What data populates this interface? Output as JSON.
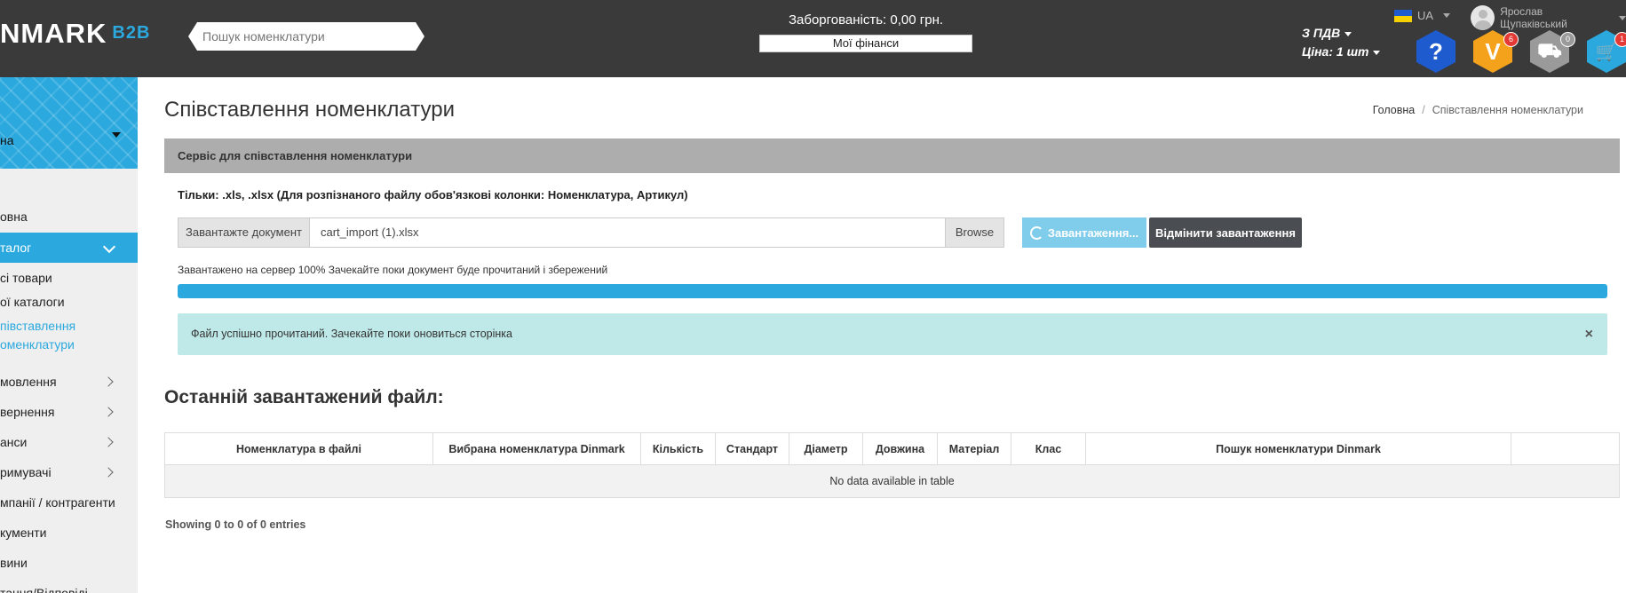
{
  "header": {
    "logo_text": "NMARK",
    "logo_suffix": "B2B",
    "search_placeholder": "Пошук номенклатури",
    "debt_label": "Заборгованість: 0,00 грн.",
    "finances_button": "Мої фінанси",
    "vat_label": "З ПДВ",
    "price_label": "Ціна: 1 шт",
    "language": "UA",
    "user_name": "Ярослав Щупаківський",
    "icons": [
      {
        "name": "help-icon",
        "glyph": "?",
        "color": "#1e5bcf",
        "badge": ""
      },
      {
        "name": "v-icon",
        "glyph": "V",
        "color": "#f4a11b",
        "badge": "6"
      },
      {
        "name": "truck-icon",
        "glyph": "⛟",
        "color": "#9a9a9a",
        "badge": "0"
      },
      {
        "name": "cart-icon",
        "glyph": "🛒",
        "color": "#2ba9de",
        "badge": "1"
      }
    ]
  },
  "sidebar": {
    "account_name": "на",
    "items": [
      {
        "label": "овна"
      },
      {
        "label": "талог"
      },
      {
        "label": "сі товари"
      },
      {
        "label": "ої каталоги"
      },
      {
        "label": "півставлення"
      },
      {
        "label": "оменклатури"
      },
      {
        "label": "мовлення"
      },
      {
        "label": "вернення"
      },
      {
        "label": "анси"
      },
      {
        "label": "римувачі"
      },
      {
        "label": "мпанії / контрагенти"
      },
      {
        "label": "кументи"
      },
      {
        "label": "вини"
      },
      {
        "label": "тання/Відповіді"
      }
    ]
  },
  "main": {
    "title": "Співставлення номенклатури",
    "breadcrumb": {
      "home": "Головна",
      "sep": "/",
      "current": "Співставлення номенклатури"
    },
    "card_title": "Сервіс для співставлення номенклатури",
    "hint": "Тільки: .xls, .xlsx (Для розпізнаного файлу обов'язкові колонки: Номенклатура, Артикул)",
    "upload": {
      "label": "Завантажте документ",
      "file_name": "cart_import (1).xlsx",
      "browse": "Browse",
      "loading_button": "Завантаження...",
      "cancel_button": "Відмінити завантаження"
    },
    "progress": {
      "text": "Завантажено на сервер 100% Зачекайте поки документ буде прочитаний і збережений",
      "percent": 100
    },
    "alert": {
      "text": "Файл успішно прочитаний. Зачекайте поки оновиться сторінка",
      "close": "×"
    },
    "section_title": "Останній завантажений файл:",
    "table": {
      "columns": [
        "Номенклатура в файлі",
        "Вибрана номенклатура Dinmark",
        "Кількість",
        "Стандарт",
        "Діаметр",
        "Довжина",
        "Матеріал",
        "Клас",
        "Пошук номенклатури Dinmark",
        ""
      ],
      "empty": "No data available in table"
    },
    "showing": "Showing 0 to 0 of 0 entries"
  },
  "colors": {
    "header_bg": "#3a3a3a",
    "accent": "#2ba9de",
    "alert_bg": "#bfe9e8",
    "card_head_bg": "#adadad",
    "cancel_btn": "#4a4d52"
  }
}
